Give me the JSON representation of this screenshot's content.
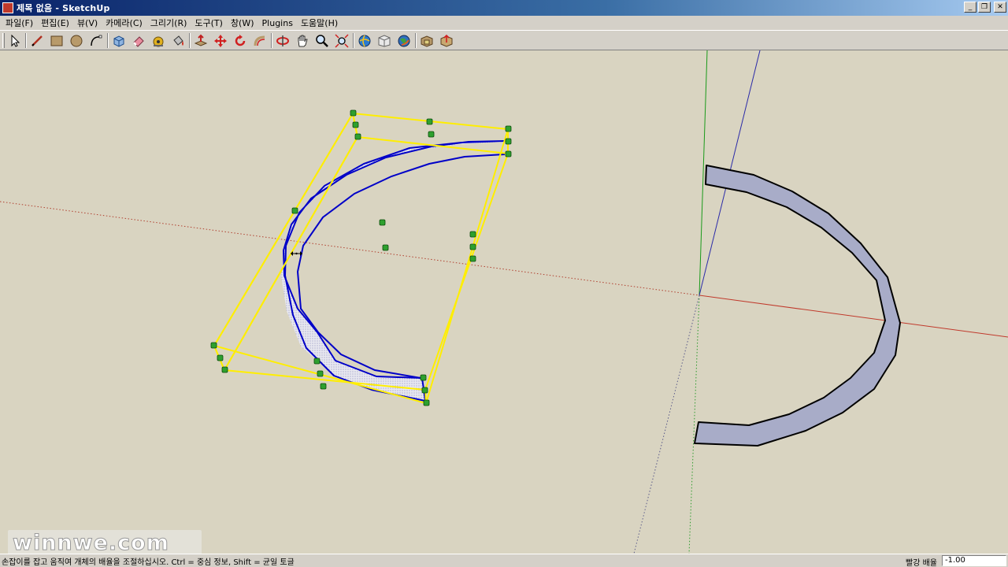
{
  "window": {
    "title": "제목 없음 - SketchUp",
    "minimize_glyph": "_",
    "maximize_glyph": "❐",
    "close_glyph": "✕"
  },
  "menu": [
    {
      "label": "파일(F)"
    },
    {
      "label": "편집(E)"
    },
    {
      "label": "뷰(V)"
    },
    {
      "label": "카메라(C)"
    },
    {
      "label": "그리기(R)"
    },
    {
      "label": "도구(T)"
    },
    {
      "label": "창(W)"
    },
    {
      "label": "Plugins"
    },
    {
      "label": "도움말(H)"
    }
  ],
  "toolbar": {
    "tools": [
      "select-icon",
      "line-icon",
      "rectangle-icon",
      "circle-icon",
      "arc-icon",
      "make-component-icon",
      "eraser-icon",
      "tape-measure-icon",
      "paint-bucket-icon",
      "push-pull-icon",
      "move-icon",
      "rotate-icon",
      "offset-icon",
      "orbit-icon",
      "pan-icon",
      "zoom-icon",
      "zoom-extents-icon",
      "get-models-icon",
      "share-model-icon",
      "google-earth-icon",
      "component-window-icon",
      "share-component-icon"
    ]
  },
  "colors": {
    "viewport_bg": "#d9d4c1",
    "selection": "#ffff00",
    "grip": "#2e8b2e",
    "face_edge": "#0000c8",
    "face_fill": "#a8acc8",
    "axis_red": "#c0392b",
    "axis_green": "#1a9a1a",
    "axis_blue": "#2a2aa8"
  },
  "watermark": "winnwe.com",
  "status": {
    "hint": "손잡이를 잡고 움직여 개체의 배율을 조절하십시오. Ctrl = 중심 정보, Shift = 균일 토글",
    "measure_label": "빨강 배율",
    "measure_value": "-1.00"
  }
}
